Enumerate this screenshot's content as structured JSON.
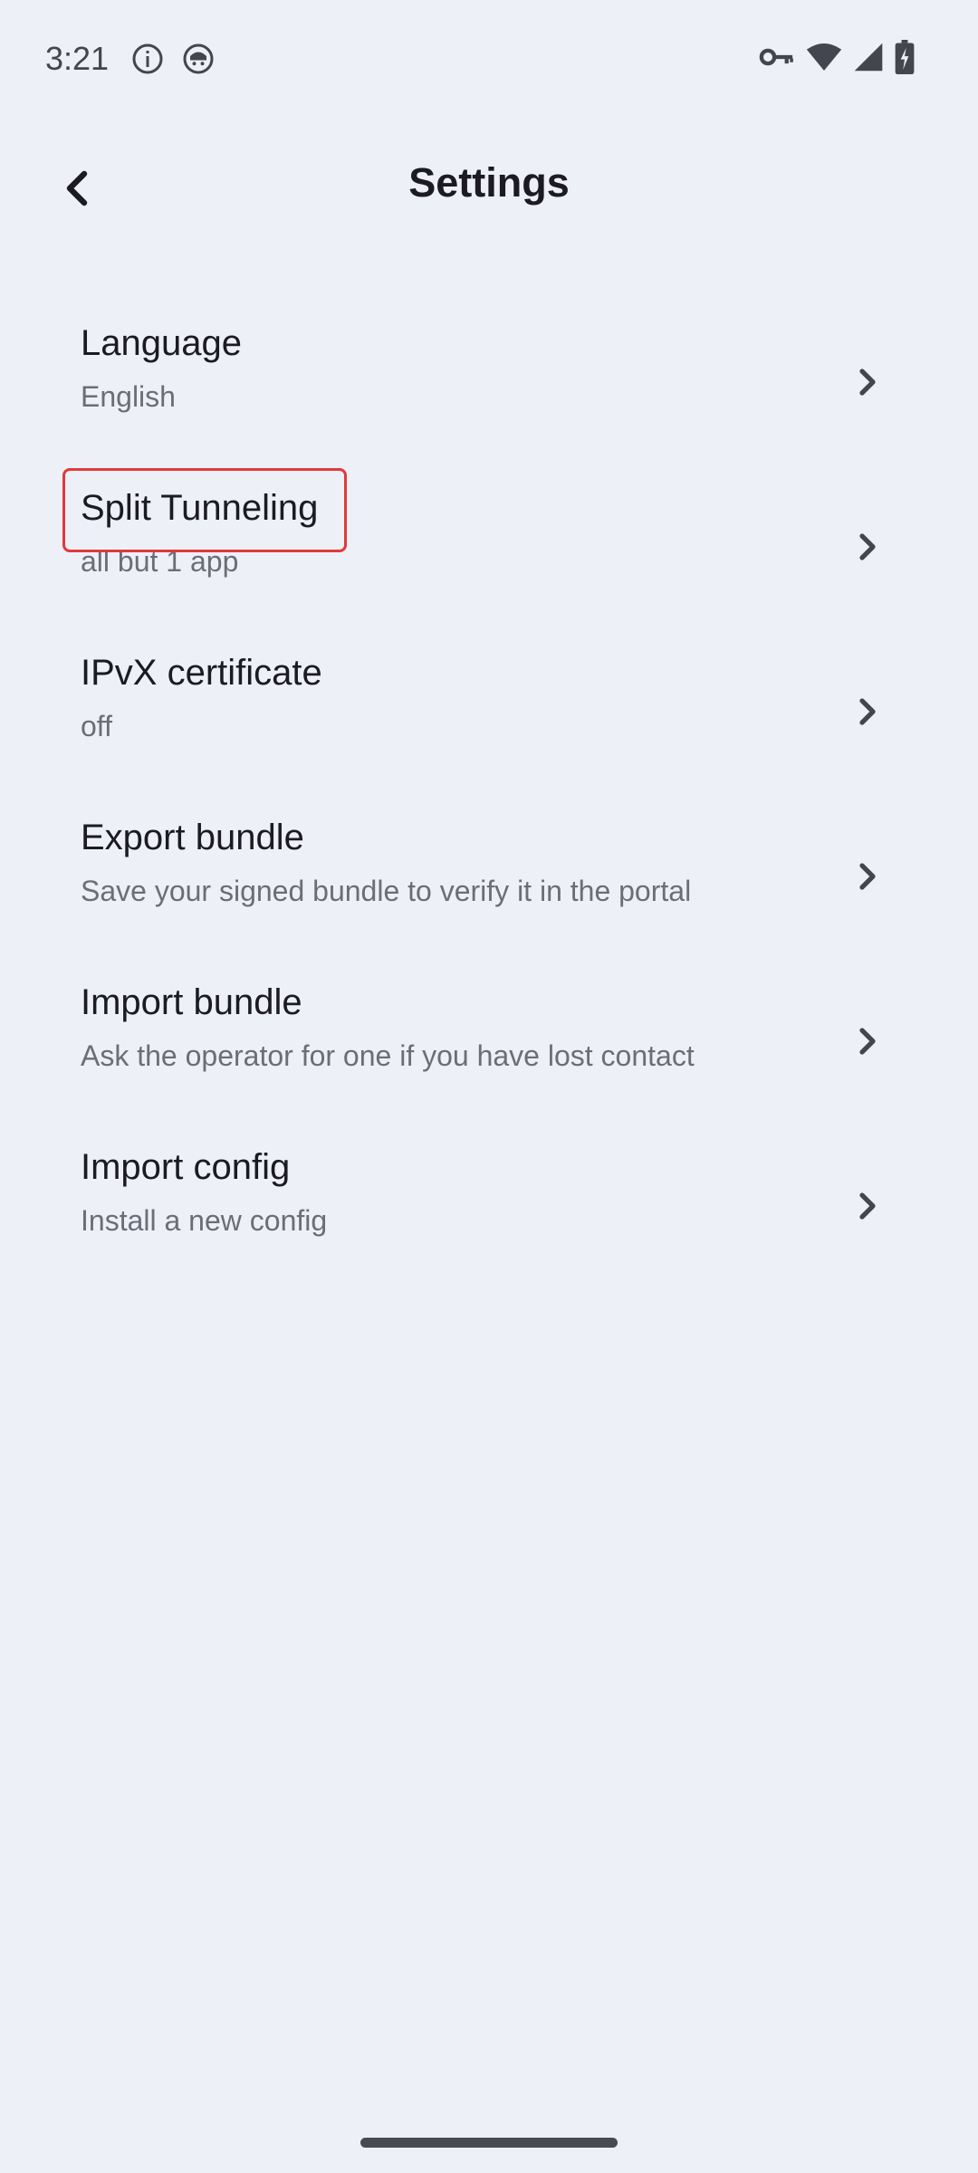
{
  "status_bar": {
    "time": "3:21",
    "icons": [
      "info-icon",
      "app-notification-icon",
      "vpn-key-icon",
      "wifi-icon",
      "cellular-signal-icon",
      "battery-charging-icon"
    ]
  },
  "header": {
    "title": "Settings",
    "back_icon": "chevron-left-icon"
  },
  "settings": {
    "items": [
      {
        "title": "Language",
        "subtitle": "English"
      },
      {
        "title": "Split Tunneling",
        "subtitle": "all but 1 app"
      },
      {
        "title": "IPvX certificate",
        "subtitle": "off"
      },
      {
        "title": "Export bundle",
        "subtitle": "Save your signed bundle to verify it in the portal"
      },
      {
        "title": "Import bundle",
        "subtitle": "Ask the operator for one if you have lost contact"
      },
      {
        "title": "Import config",
        "subtitle": "Install a new config"
      }
    ]
  },
  "colors": {
    "background": "#eef0f8",
    "title_text": "#1b1b21",
    "subtitle_text": "#6b6e78",
    "highlight": "#e03a3a"
  }
}
